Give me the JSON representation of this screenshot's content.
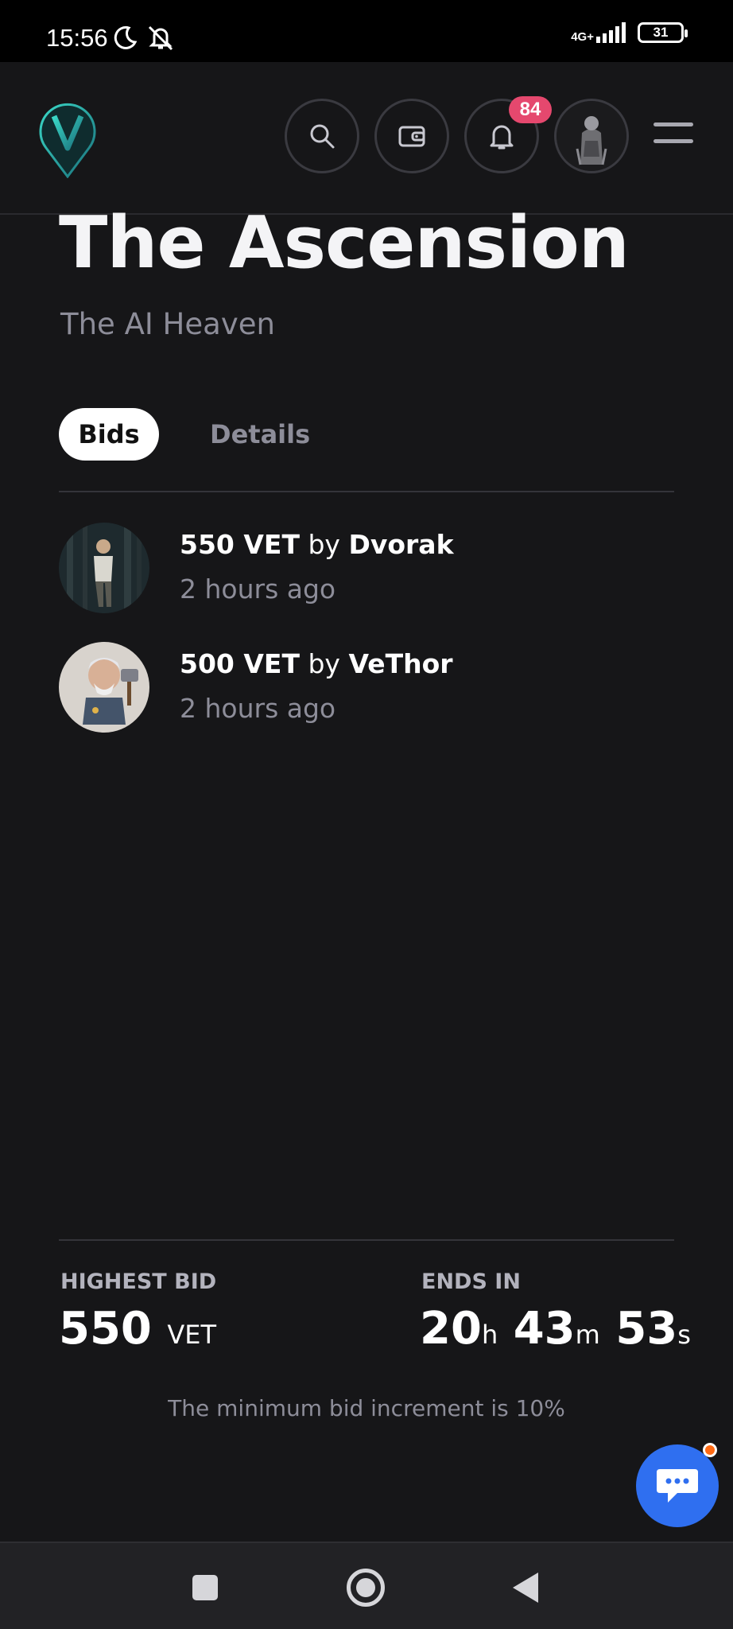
{
  "status_bar": {
    "time": "15:56",
    "network": "4G+",
    "battery": "31",
    "icons": [
      "moon-icon",
      "alarm-off-icon",
      "signal-icon",
      "battery-icon"
    ]
  },
  "header": {
    "notification_count": "84",
    "icons": [
      "logo-icon",
      "search-icon",
      "wallet-icon",
      "bell-icon",
      "avatar-image",
      "menu-icon"
    ]
  },
  "auction": {
    "title": "The Ascension",
    "subtitle": "The AI Heaven"
  },
  "tabs": [
    {
      "label": "Bids",
      "active": true
    },
    {
      "label": "Details",
      "active": false
    }
  ],
  "bids": [
    {
      "amount": "550 VET",
      "by": "by",
      "user": "Dvorak",
      "time": "2 hours ago"
    },
    {
      "amount": "500 VET",
      "by": "by",
      "user": "VeThor",
      "time": "2 hours ago"
    }
  ],
  "summary": {
    "highest_bid_label": "HIGHEST BID",
    "highest_bid_value": "550",
    "highest_bid_unit": "VET",
    "ends_in_label": "ENDS IN",
    "hours": "20",
    "hours_unit": "h",
    "minutes": "43",
    "minutes_unit": "m",
    "seconds": "53",
    "seconds_unit": "s",
    "note": "The minimum bid increment is 10%"
  },
  "colors": {
    "background": "#161618",
    "badge": "#e5486e",
    "chat_fab": "#2f6ff0",
    "muted_text": "#8d8d99"
  }
}
